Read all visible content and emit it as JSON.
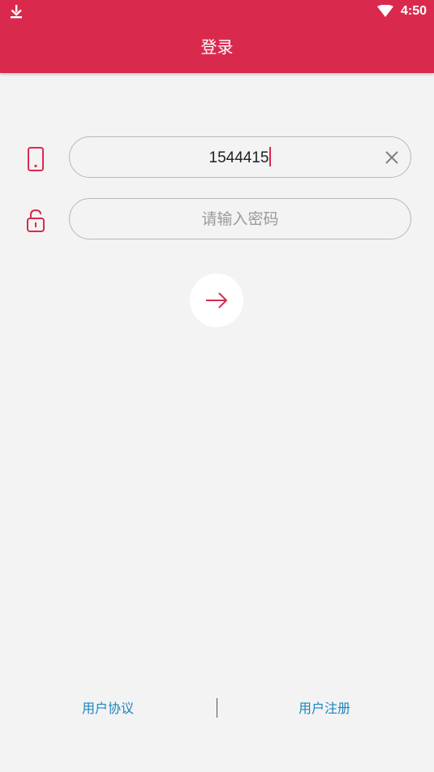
{
  "status_bar": {
    "time": "4:50",
    "icons": [
      "download-icon",
      "wifi-icon"
    ]
  },
  "header": {
    "title": "登录",
    "background_color": "#d92a4e"
  },
  "form": {
    "phone": {
      "icon": "phone-icon",
      "value": "1544415",
      "clear_icon": "close-icon"
    },
    "password": {
      "icon": "unlock-icon",
      "placeholder": "请输入密码"
    },
    "submit_icon": "arrow-right-icon"
  },
  "footer": {
    "agreement_label": "用户协议",
    "register_label": "用户注册",
    "link_color": "#1a85bf"
  }
}
